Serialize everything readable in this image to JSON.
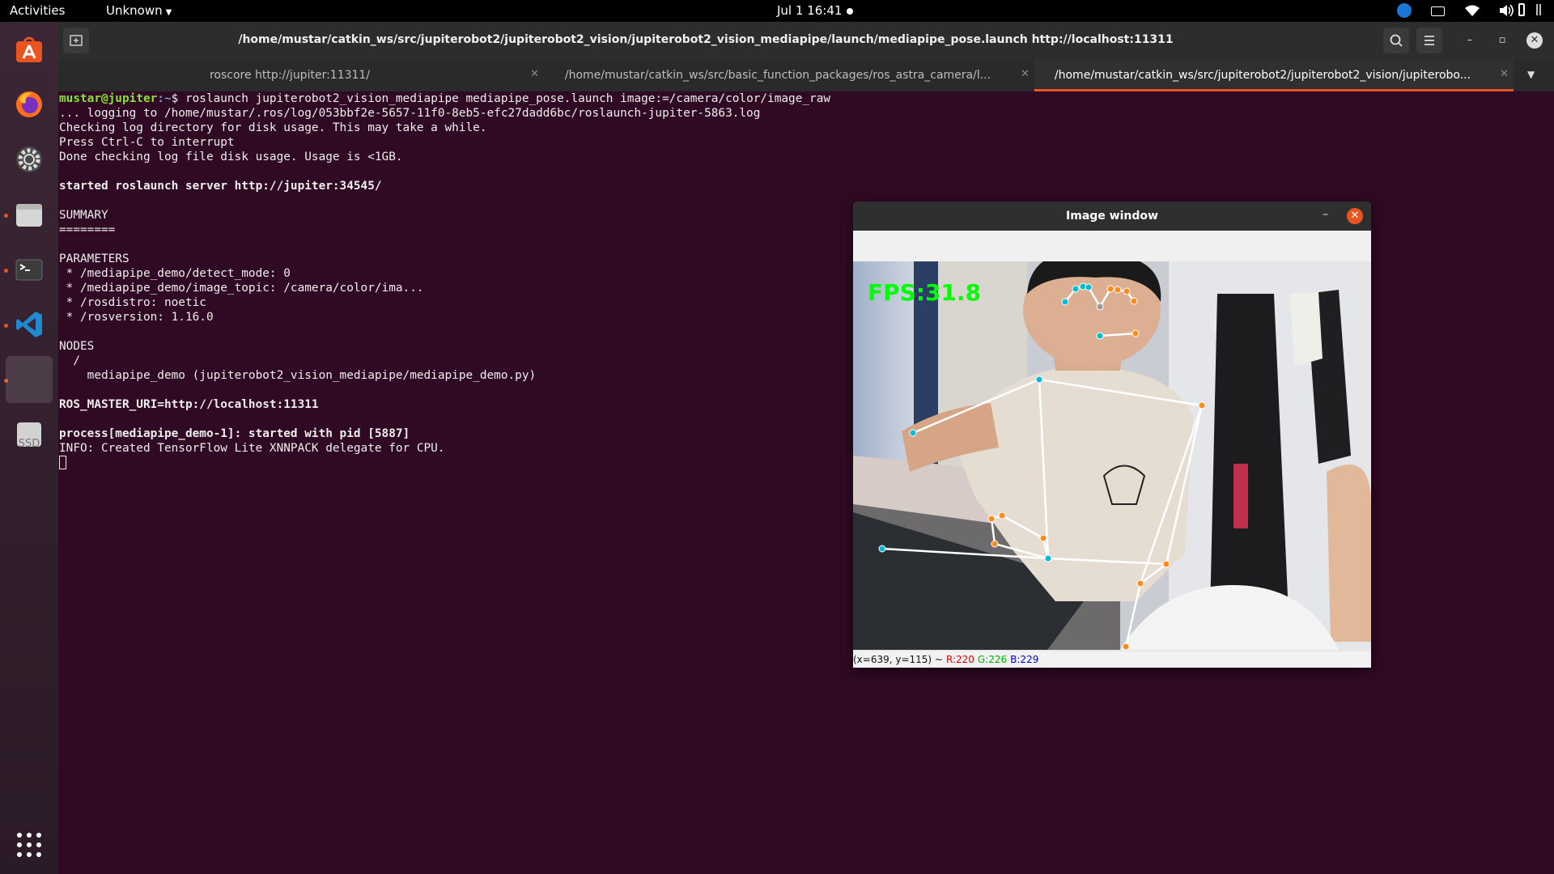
{
  "topbar": {
    "activities": "Activities",
    "app_menu": "Unknown",
    "clock": "Jul 1  16:41"
  },
  "dock": {
    "items": [
      {
        "name": "Ubuntu Software",
        "icon": "ubuntu-software-icon"
      },
      {
        "name": "Firefox",
        "icon": "firefox-icon"
      },
      {
        "name": "Settings",
        "icon": "settings-gear-icon"
      },
      {
        "name": "Files",
        "icon": "files-folder-icon"
      },
      {
        "name": "Terminal",
        "icon": "terminal-icon"
      },
      {
        "name": "Visual Studio Code",
        "icon": "vscode-icon"
      },
      {
        "name": "Image window",
        "icon": "blank-app-icon"
      },
      {
        "name": "SSD",
        "icon": "drive-icon",
        "label": "SSD"
      }
    ],
    "show_apps_icon": "grid-icon"
  },
  "terminal": {
    "title": "/home/mustar/catkin_ws/src/jupiterobot2/jupiterobot2_vision/jupiterobot2_vision_mediapipe/launch/mediapipe_pose.launch http://localhost:11311",
    "tabs": [
      {
        "label": "roscore http://jupiter:11311/",
        "active": false
      },
      {
        "label": "/home/mustar/catkin_ws/src/basic_function_packages/ros_astra_camera/l...",
        "active": false
      },
      {
        "label": "/home/mustar/catkin_ws/src/jupiterobot2/jupiterobot2_vision/jupiterobo...",
        "active": true
      }
    ],
    "prompt_user": "mustar@jupiter",
    "prompt_path": ":~",
    "prompt_symbol": "$ ",
    "command": "roslaunch jupiterobot2_vision_mediapipe mediapipe_pose.launch image:=/camera/color/image_raw",
    "lines": [
      "... logging to /home/mustar/.ros/log/053bbf2e-5657-11f0-8eb5-efc27dadd6bc/roslaunch-jupiter-5863.log",
      "Checking log directory for disk usage. This may take a while.",
      "Press Ctrl-C to interrupt",
      "Done checking log file disk usage. Usage is <1GB.",
      "",
      "started roslaunch server http://jupiter:34545/",
      "",
      "SUMMARY",
      "========",
      "",
      "PARAMETERS",
      " * /mediapipe_demo/detect_mode: 0",
      " * /mediapipe_demo/image_topic: /camera/color/ima...",
      " * /rosdistro: noetic",
      " * /rosversion: 1.16.0",
      "",
      "NODES",
      "  /",
      "    mediapipe_demo (jupiterobot2_vision_mediapipe/mediapipe_demo.py)",
      "",
      "ROS_MASTER_URI=http://localhost:11311",
      "",
      "process[mediapipe_demo-1]: started with pid [5887]",
      "INFO: Created TensorFlow Lite XNNPACK delegate for CPU."
    ]
  },
  "image_window": {
    "title": "Image window",
    "fps_text": "FPS:31.8",
    "status": {
      "coords": "(x=639, y=115) ~",
      "r": "R:220",
      "g": "G:226",
      "b": "B:229"
    }
  },
  "colors": {
    "terminal_bg": "#300a24",
    "accent": "#e95420",
    "prompt_user": "#8ae234",
    "prompt_path": "#729fcf",
    "pose_left": "#00bcd4",
    "pose_right": "#ff8c1a",
    "fps_green": "#00ff00"
  }
}
